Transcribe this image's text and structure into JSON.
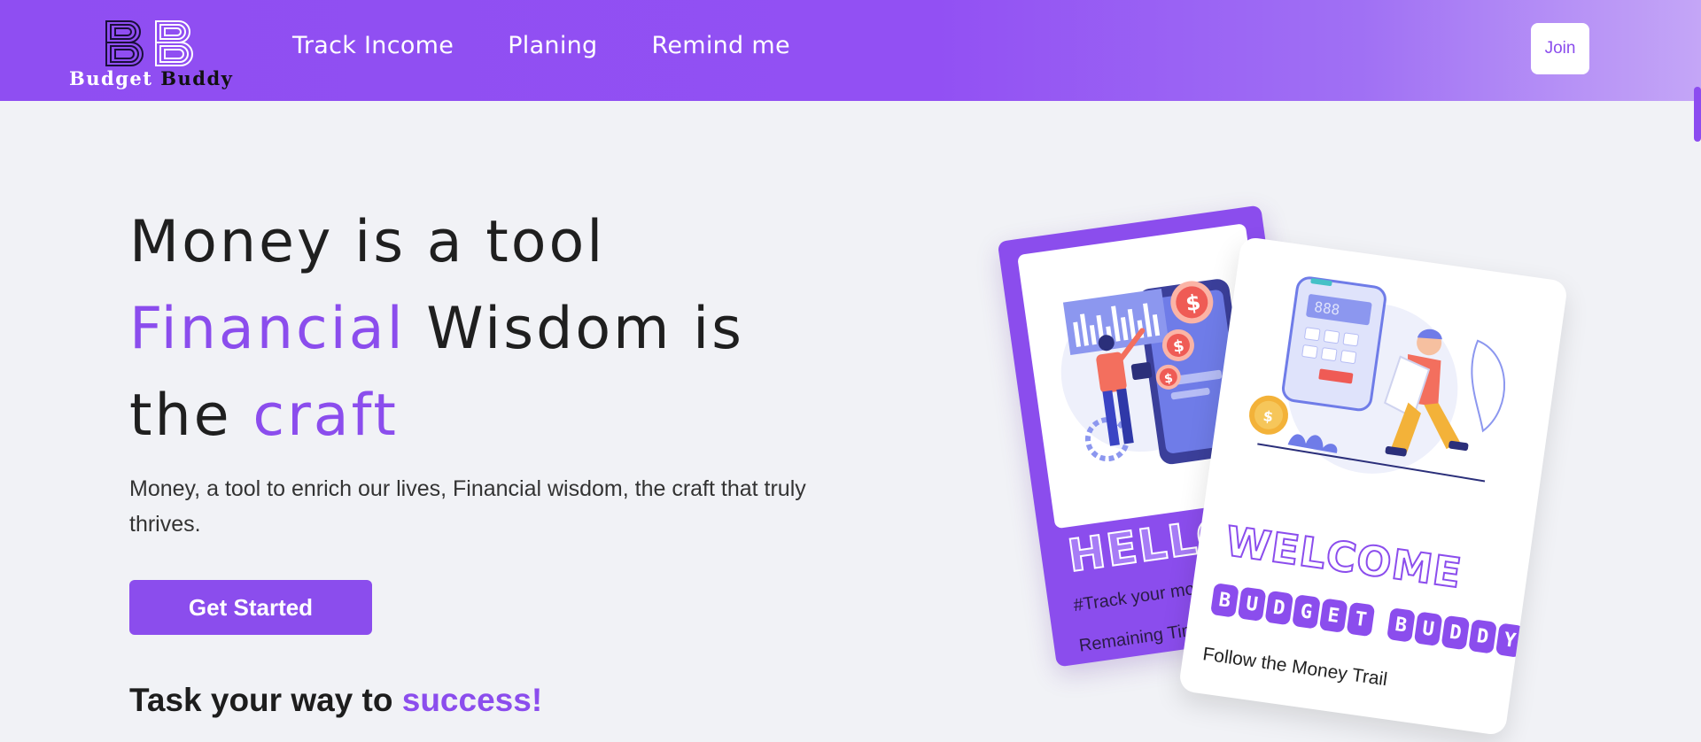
{
  "nav": {
    "logo_word1": "Budget",
    "logo_word2": "Buddy",
    "links": [
      "Track Income",
      "Planing",
      "Remind me"
    ],
    "join_label": "Join"
  },
  "hero": {
    "title_line1": "Money is a tool",
    "title_accent1": "Financial",
    "title_mid": " Wisdom is",
    "title_the": "the ",
    "title_accent2": "craft",
    "description": "Money, a tool to enrich our lives, Financial wisdom, the craft that truly thrives.",
    "cta_label": "Get Started",
    "task_prefix": "Task your way to ",
    "task_accent": "success!"
  },
  "cards": {
    "purple": {
      "hello": "HELLO",
      "line1": "#Track your money",
      "line2": "Remaining Time"
    },
    "white": {
      "welcome": "WELCOME",
      "brand_letters": [
        "B",
        "U",
        "D",
        "G",
        "E",
        "T",
        " ",
        "B",
        "U",
        "D",
        "D",
        "Y"
      ],
      "tagline": "Follow the Money Trail",
      "calc_display": "888"
    }
  },
  "colors": {
    "accent": "#8b4ded",
    "navbar_start": "#8f4ef2",
    "navbar_end": "#c4a6f7",
    "background": "#f1f2f6"
  }
}
